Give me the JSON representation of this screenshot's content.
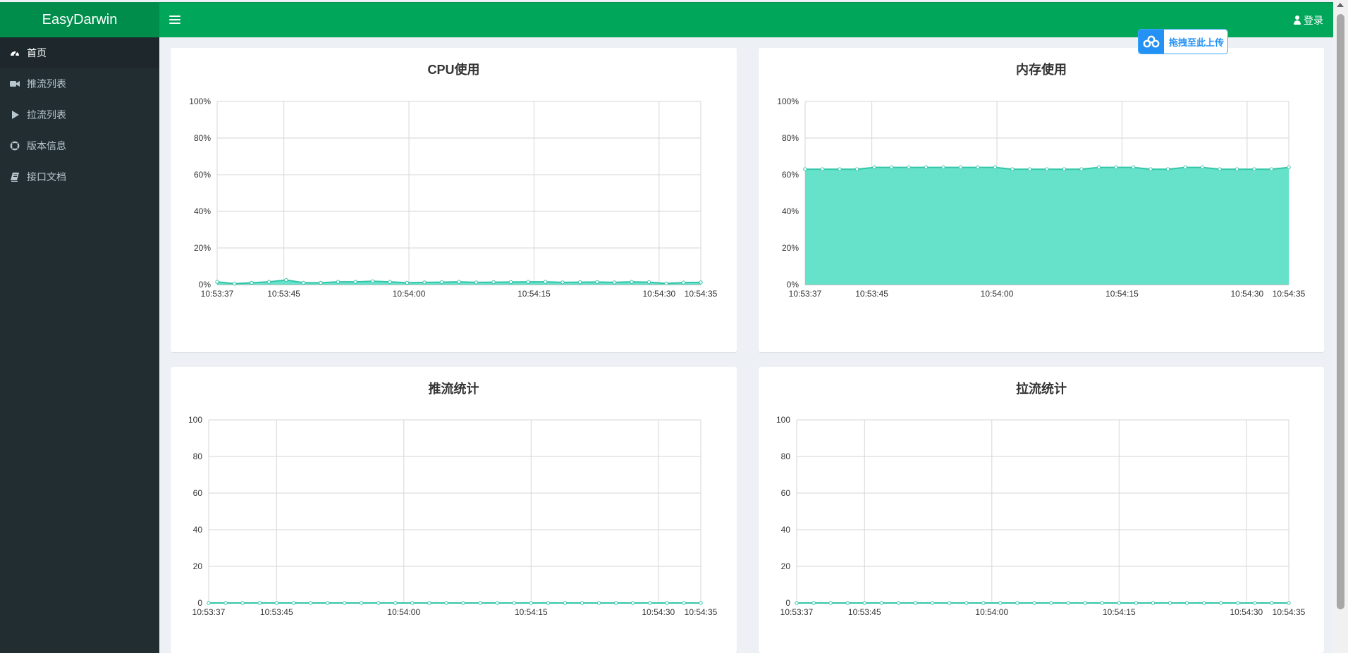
{
  "header": {
    "app_title": "EasyDarwin",
    "login_label": "登录",
    "colors": {
      "header_bg": "#00a65a",
      "logo_bg": "#008d4c",
      "sidebar_bg": "#222d32",
      "accent_fill": "#5ee0c8",
      "accent_line": "#33c5a7"
    }
  },
  "sidebar": {
    "items": [
      {
        "label": "首页",
        "icon": "dashboard-icon",
        "active": true
      },
      {
        "label": "推流列表",
        "icon": "video-camera-icon",
        "active": false
      },
      {
        "label": "拉流列表",
        "icon": "play-icon",
        "active": false
      },
      {
        "label": "版本信息",
        "icon": "life-ring-icon",
        "active": false
      },
      {
        "label": "接口文档",
        "icon": "book-icon",
        "active": false
      }
    ]
  },
  "upload_widget": {
    "label": "拖拽至此上传",
    "icon": "baidu-cloud-icon"
  },
  "chart_data": [
    {
      "id": "cpu",
      "type": "area",
      "title": "CPU使用",
      "x_ticks": [
        "10:53:37",
        "10:53:45",
        "10:54:00",
        "10:54:15",
        "10:54:30",
        "10:54:35"
      ],
      "y_ticks": [
        "0%",
        "20%",
        "40%",
        "60%",
        "80%",
        "100%"
      ],
      "ylim": [
        0,
        100
      ],
      "grid": true,
      "values": [
        1.5,
        0.5,
        1.0,
        1.5,
        2.5,
        1.0,
        1.0,
        1.5,
        1.5,
        1.8,
        1.5,
        1.0,
        1.2,
        1.3,
        1.5,
        1.2,
        1.3,
        1.4,
        1.5,
        1.5,
        1.2,
        1.3,
        1.4,
        1.2,
        1.5,
        1.3,
        0.6,
        1.1,
        1.2
      ]
    },
    {
      "id": "memory",
      "type": "area",
      "title": "内存使用",
      "x_ticks": [
        "10:53:37",
        "10:53:45",
        "10:54:00",
        "10:54:15",
        "10:54:30",
        "10:54:35"
      ],
      "y_ticks": [
        "0%",
        "20%",
        "40%",
        "60%",
        "80%",
        "100%"
      ],
      "ylim": [
        0,
        100
      ],
      "grid": true,
      "values": [
        63,
        63,
        63,
        63,
        64,
        64,
        64,
        64,
        64,
        64,
        64,
        64,
        63,
        63,
        63,
        63,
        63,
        64,
        64,
        64,
        63,
        63,
        64,
        64,
        63,
        63,
        63,
        63,
        64
      ]
    },
    {
      "id": "push",
      "type": "line",
      "title": "推流统计",
      "x_ticks": [
        "10:53:37",
        "10:53:45",
        "10:54:00",
        "10:54:15",
        "10:54:30",
        "10:54:35"
      ],
      "y_ticks": [
        "0",
        "20",
        "40",
        "60",
        "80",
        "100"
      ],
      "ylim": [
        0,
        100
      ],
      "grid": true,
      "values": [
        0,
        0,
        0,
        0,
        0,
        0,
        0,
        0,
        0,
        0,
        0,
        0,
        0,
        0,
        0,
        0,
        0,
        0,
        0,
        0,
        0,
        0,
        0,
        0,
        0,
        0,
        0,
        0,
        0,
        0
      ]
    },
    {
      "id": "pull",
      "type": "line",
      "title": "拉流统计",
      "x_ticks": [
        "10:53:37",
        "10:53:45",
        "10:54:00",
        "10:54:15",
        "10:54:30",
        "10:54:35"
      ],
      "y_ticks": [
        "0",
        "20",
        "40",
        "60",
        "80",
        "100"
      ],
      "ylim": [
        0,
        100
      ],
      "grid": true,
      "values": [
        0,
        0,
        0,
        0,
        0,
        0,
        0,
        0,
        0,
        0,
        0,
        0,
        0,
        0,
        0,
        0,
        0,
        0,
        0,
        0,
        0,
        0,
        0,
        0,
        0,
        0,
        0,
        0,
        0,
        0
      ]
    }
  ]
}
